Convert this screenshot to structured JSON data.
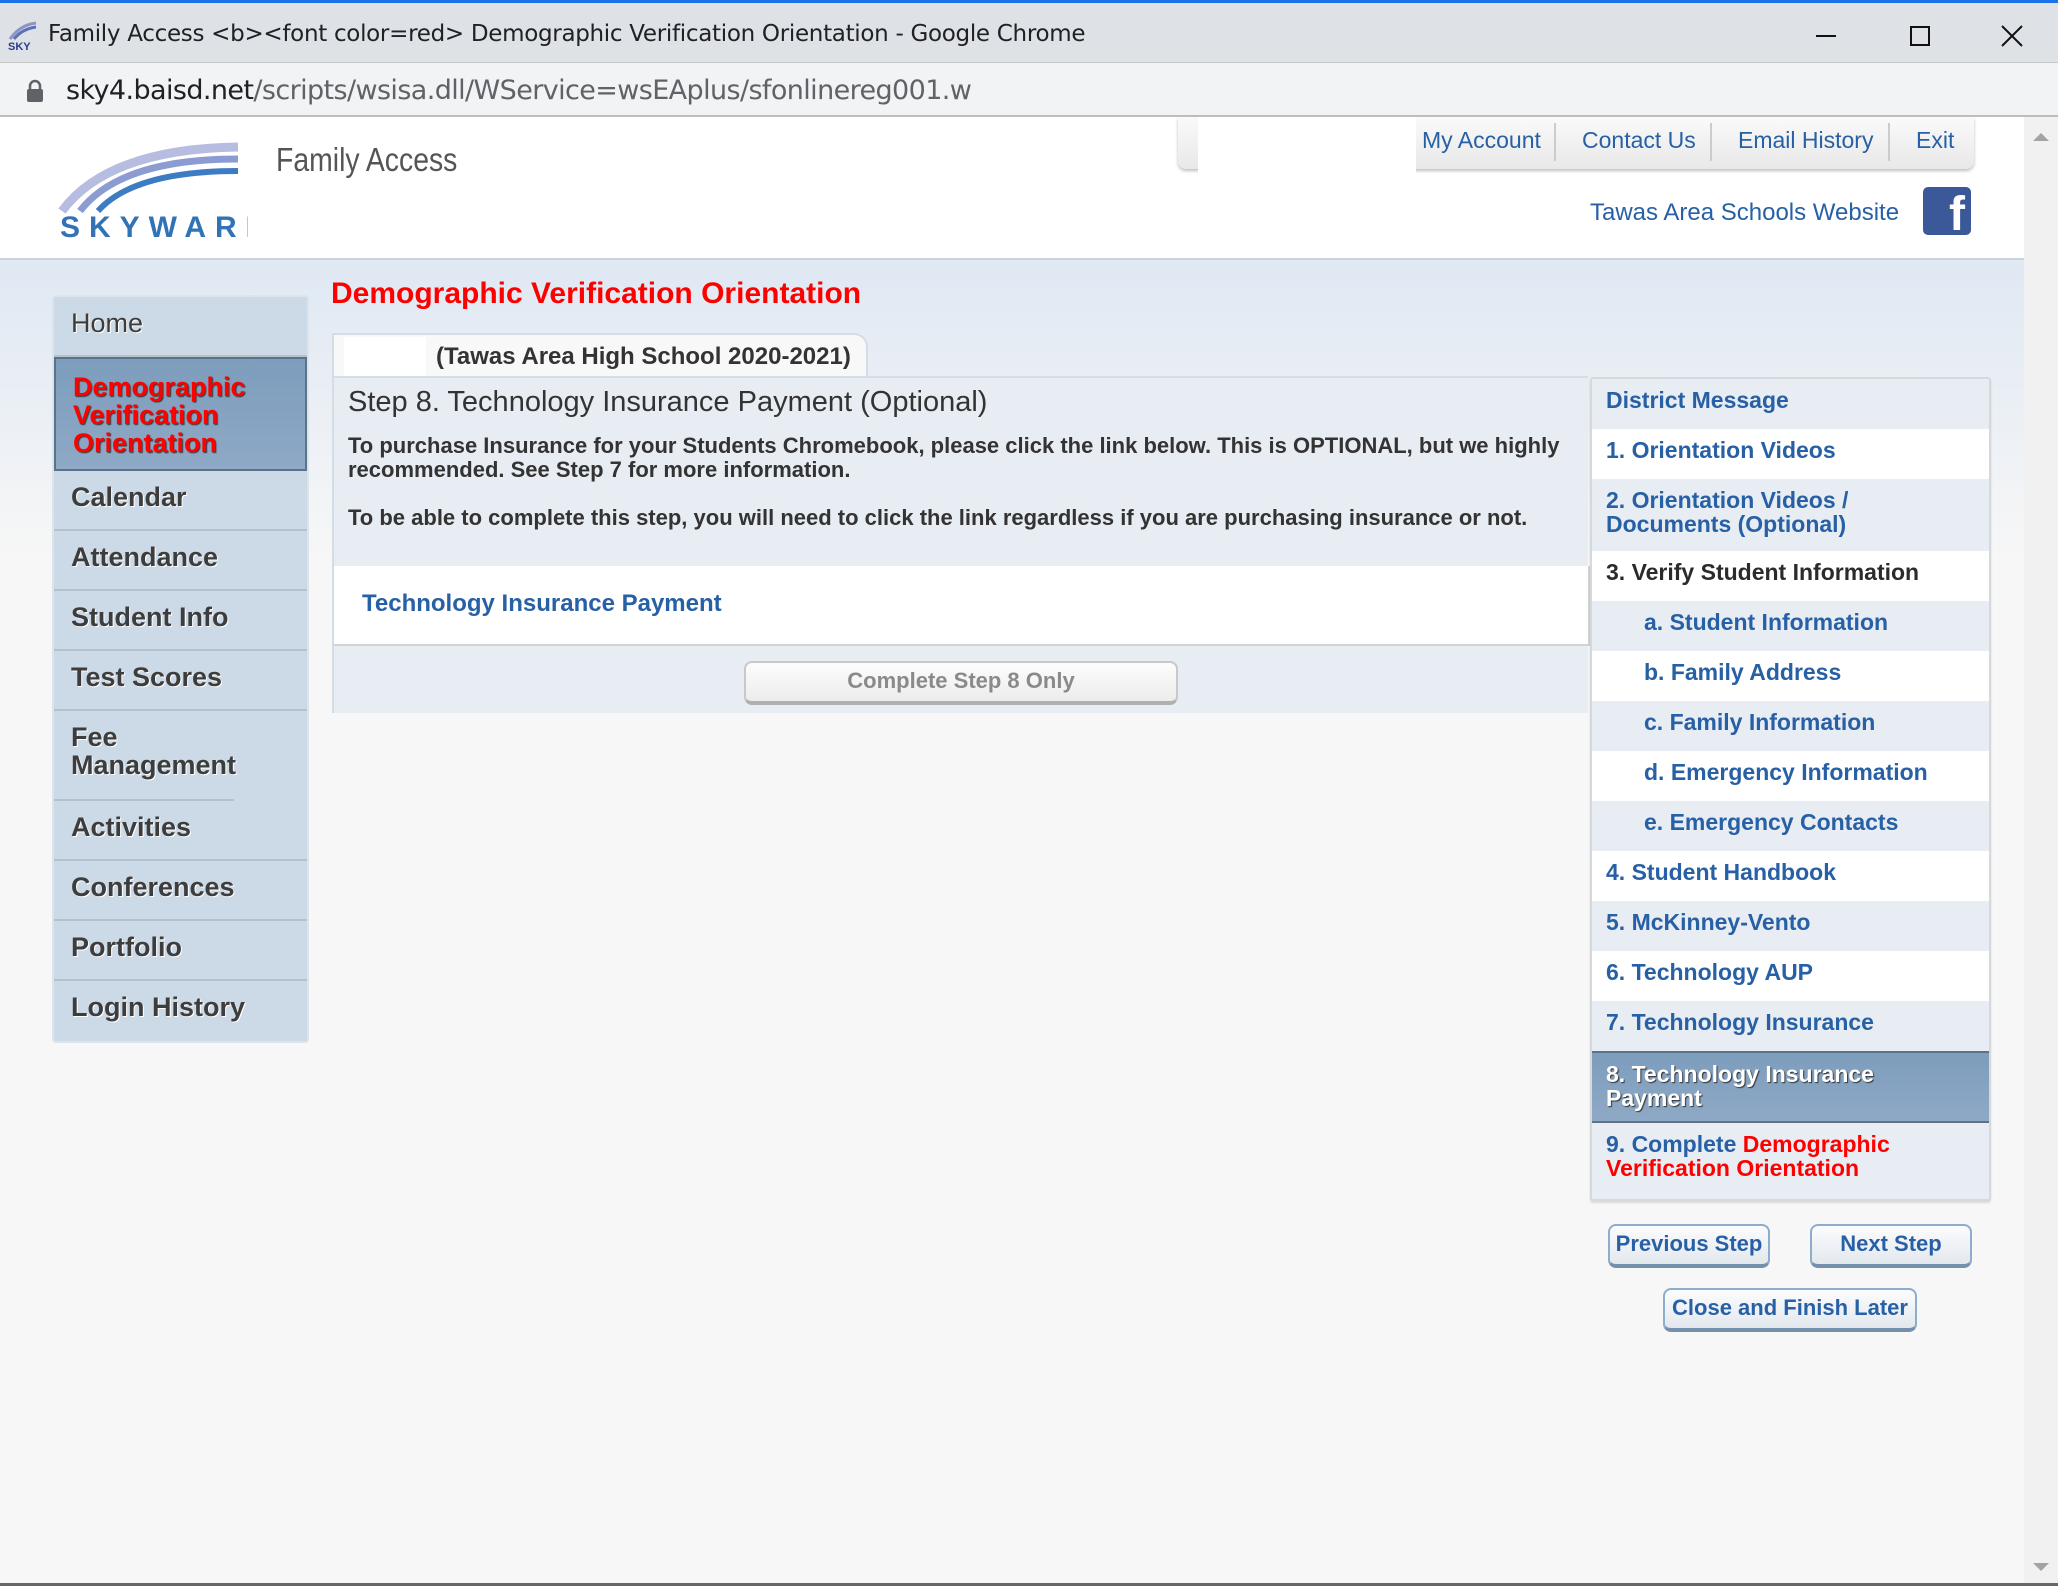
{
  "browser": {
    "window_title": "Family Access <b><font color=red> Demographic Verification Orientation - Google Chrome",
    "url_host": "sky4.baisd.net",
    "url_path": "/scripts/wsisa.dll/WService=wsEAplus/sfonlinereg001.w",
    "controls": {
      "minimize": "minimize-icon",
      "maximize": "maximize-icon",
      "close": "close-icon"
    }
  },
  "header": {
    "logo_text": "SKYWARD",
    "app_name": "Family Access",
    "top_nav": [
      "My Account",
      "Contact Us",
      "Email History",
      "Exit"
    ],
    "school_link": "Tawas Area Schools Website",
    "social_icon": "facebook-icon"
  },
  "sidebar": {
    "items": [
      {
        "label": "Home"
      },
      {
        "label": "Demographic Verification Orientation",
        "active": true
      },
      {
        "label": "Calendar"
      },
      {
        "label": "Attendance"
      },
      {
        "label": "Student Info"
      },
      {
        "label": "Test Scores"
      },
      {
        "label": "Fee Management"
      },
      {
        "label": "Activities"
      },
      {
        "label": "Conferences"
      },
      {
        "label": "Portfolio"
      },
      {
        "label": "Login History"
      }
    ]
  },
  "main": {
    "page_title": "Demographic Verification Orientation",
    "tab_label": "(Tawas Area High School 2020-2021)",
    "step_title": "Step 8. Technology Insurance Payment (Optional)",
    "paragraph1": "To purchase Insurance for your Students Chromebook, please click the link below. This is OPTIONAL, but we highly recommended. See Step 7 for more information.",
    "paragraph2": "To be able to complete this step, you will need to click the link regardless if you are purchasing insurance or not.",
    "link_label": "Technology Insurance Payment",
    "complete_button": "Complete Step 8 Only"
  },
  "steps": {
    "items": [
      {
        "label": "District Message"
      },
      {
        "label": "1. Orientation Videos"
      },
      {
        "label": "2. Orientation Videos / Documents (Optional)"
      },
      {
        "label": "3. Verify Student Information"
      },
      {
        "label": "a. Student Information"
      },
      {
        "label": "b. Family Address"
      },
      {
        "label": "c. Family Information"
      },
      {
        "label": "d. Emergency Information"
      },
      {
        "label": "e. Emergency Contacts"
      },
      {
        "label": "4. Student Handbook"
      },
      {
        "label": "5. McKinney-Vento"
      },
      {
        "label": "6. Technology AUP"
      },
      {
        "label": "7. Technology Insurance"
      },
      {
        "label": "8. Technology Insurance Payment",
        "active": true
      },
      {
        "label_prefix": "9. Complete ",
        "label_red": "Demographic Verification Orientation"
      }
    ],
    "previous_button": "Previous Step",
    "next_button": "Next Step",
    "close_button": "Close and Finish Later"
  },
  "colors": {
    "accent_red": "#ff0000",
    "link_blue": "#2760a4",
    "active_bg": "#8ea9c6",
    "facebook": "#3b5998"
  }
}
